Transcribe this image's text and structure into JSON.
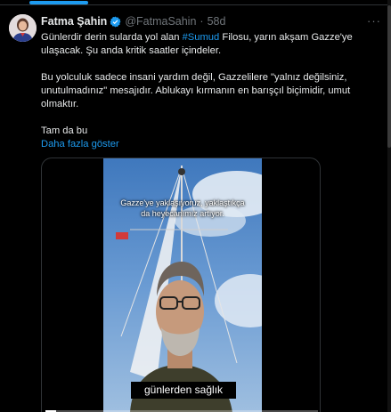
{
  "tweet": {
    "author_name": "Fatma Şahin",
    "handle": "@FatmaSahin",
    "separator": "·",
    "time": "58d",
    "verified_icon": "verified-badge-icon",
    "more_icon": "more-icon",
    "body": {
      "p1_before": "Günlerdir derin sularda yol alan ",
      "p1_hashtag": "#Sumud",
      "p1_after": " Filosu, yarın akşam Gazze'ye ulaşacak. Şu anda kritik saatler içindeler.",
      "p2": "Bu yolculuk sadece insani yardım değil, Gazzelilere \"yalnız değilsiniz, unutulmadınız\" mesajıdır. Ablukayı kırmanın en barışçıl biçimidir, umut olmaktır.",
      "p3": "Tam da bu"
    },
    "show_more": "Daha fazla göster"
  },
  "video": {
    "caption_top": "Gazze'ye yaklaşıyoruz, yaklaştıkça da heyecanımız artıyor.",
    "caption_bottom": "günlerden sağlık",
    "progress": 0.04
  },
  "colors": {
    "background": "#000000",
    "text": "#e7e9ea",
    "muted": "#71767b",
    "accent": "#1d9bf0"
  }
}
